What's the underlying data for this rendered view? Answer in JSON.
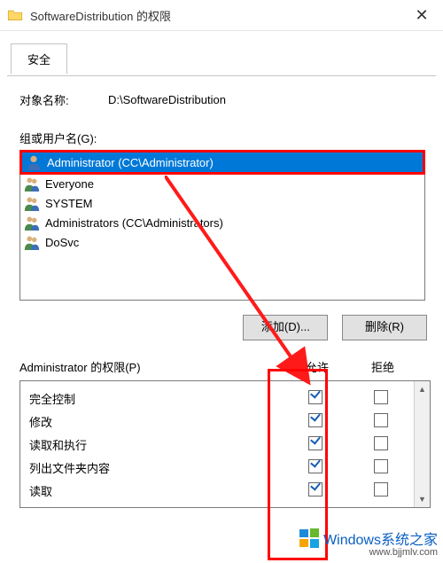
{
  "title": "SoftwareDistribution 的权限",
  "tab_label": "安全",
  "object_label": "对象名称:",
  "object_value": "D:\\SoftwareDistribution",
  "group_label": "组或用户名(G):",
  "users": [
    {
      "name": "Administrator (CC\\Administrator)",
      "type": "user",
      "selected": true
    },
    {
      "name": "Everyone",
      "type": "users",
      "selected": false
    },
    {
      "name": "SYSTEM",
      "type": "users",
      "selected": false
    },
    {
      "name": "Administrators (CC\\Administrators)",
      "type": "users",
      "selected": false
    },
    {
      "name": "DoSvc",
      "type": "users",
      "selected": false
    }
  ],
  "btn_add": "添加(D)...",
  "btn_remove": "删除(R)",
  "perm_label": "Administrator 的权限(P)",
  "col_allow": "允许",
  "col_deny": "拒绝",
  "perms": [
    {
      "name": "完全控制",
      "allow": true,
      "deny": false
    },
    {
      "name": "修改",
      "allow": true,
      "deny": false
    },
    {
      "name": "读取和执行",
      "allow": true,
      "deny": false
    },
    {
      "name": "列出文件夹内容",
      "allow": true,
      "deny": false
    },
    {
      "name": "读取",
      "allow": true,
      "deny": false
    }
  ],
  "watermark_main": "Windows系统之家",
  "watermark_url": "www.bjjmlv.com"
}
